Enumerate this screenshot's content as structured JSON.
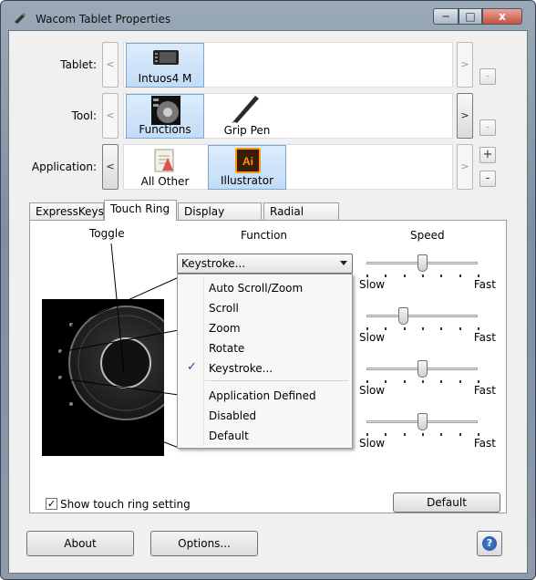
{
  "window": {
    "title": "Wacom Tablet Properties",
    "minimize": "─",
    "maximize": "□",
    "close": "x"
  },
  "rows": {
    "tablet": {
      "label": "Tablet:",
      "items": [
        "Intuos4 M"
      ]
    },
    "tool": {
      "label": "Tool:",
      "items": [
        "Functions",
        "Grip Pen"
      ]
    },
    "application": {
      "label": "Application:",
      "items": [
        "All Other",
        "Illustrator"
      ]
    }
  },
  "nav": {
    "left": "<",
    "right": ">"
  },
  "side_buttons": {
    "minus": "-",
    "plus": "+"
  },
  "tabs": [
    "ExpressKeys",
    "Touch Ring",
    "Display Toggle",
    "Radial Menu"
  ],
  "active_tab": "Touch Ring",
  "panel": {
    "toggle_header": "Toggle",
    "function_header": "Function",
    "speed_header": "Speed",
    "function_value": "Keystroke...",
    "menu_items": [
      "Auto Scroll/Zoom",
      "Scroll",
      "Zoom",
      "Rotate",
      "Keystroke...",
      "Application Defined",
      "Disabled",
      "Default"
    ],
    "menu_checked": "Keystroke...",
    "check_glyph": "✓",
    "sliders": [
      {
        "slow": "Slow",
        "fast": "Fast",
        "level": 0.5
      },
      {
        "slow": "Slow",
        "fast": "Fast",
        "level": 0.33
      },
      {
        "slow": "Slow",
        "fast": "Fast",
        "level": 0.5
      },
      {
        "slow": "Slow",
        "fast": "Fast",
        "level": 0.5
      }
    ],
    "show_setting_label": "Show touch ring setting",
    "show_setting_checked": true,
    "default_button": "Default"
  },
  "footer": {
    "about": "About",
    "options": "Options...",
    "help": "?"
  },
  "colors": {
    "selected_bg": "#c3dcf5",
    "illustrator_orange": "#f7941d"
  }
}
